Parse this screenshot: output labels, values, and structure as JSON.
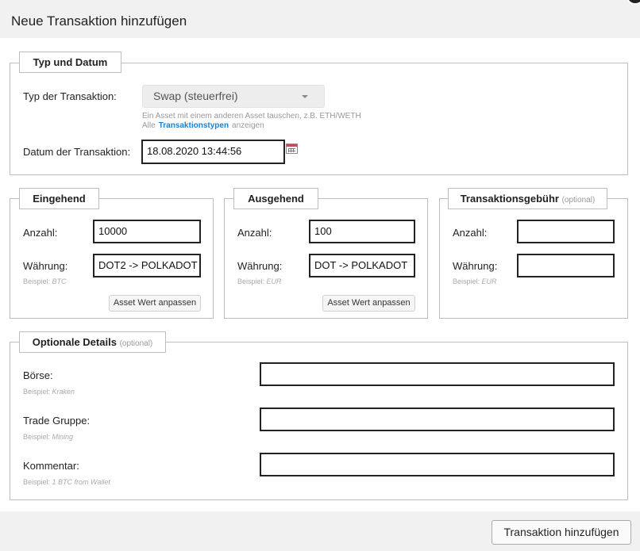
{
  "dialog": {
    "title": "Neue Transaktion hinzufügen"
  },
  "type_section": {
    "legend": "Typ und Datum",
    "type_label": "Typ der Transaktion:",
    "type_value": "Swap (steuerfrei)",
    "type_hint": "Ein Asset mit einem anderen Asset tauschen, z.B. ETH/WETH",
    "hint_prefix": "Alle",
    "hint_link": "Transaktionstypen",
    "hint_suffix": "anzeigen",
    "date_label": "Datum der Transaktion:",
    "date_value": "18.08.2020 13:44:56"
  },
  "incoming": {
    "legend": "Eingehend",
    "amount_label": "Anzahl:",
    "amount_value": "10000",
    "currency_label": "Währung:",
    "currency_value": "DOT2 -> POLKADOT",
    "example_prefix": "Beispiel:",
    "example_value": "BTC",
    "adjust_button": "Asset Wert anpassen"
  },
  "outgoing": {
    "legend": "Ausgehend",
    "amount_label": "Anzahl:",
    "amount_value": "100",
    "currency_label": "Währung:",
    "currency_value": "DOT -> POLKADOT",
    "example_prefix": "Beispiel:",
    "example_value": "EUR",
    "adjust_button": "Asset Wert anpassen"
  },
  "fee": {
    "legend": "Transaktionsgebühr",
    "legend_optional": "(optional)",
    "amount_label": "Anzahl:",
    "amount_value": "",
    "currency_label": "Währung:",
    "currency_value": "",
    "example_prefix": "Beispiel:",
    "example_value": "EUR"
  },
  "optional": {
    "legend": "Optionale Details",
    "legend_optional": "(optional)",
    "exchange_label": "Börse:",
    "exchange_example_prefix": "Beispiel:",
    "exchange_example": "Kraken",
    "exchange_value": "",
    "group_label": "Trade Gruppe:",
    "group_example_prefix": "Beispiel:",
    "group_example": "Mining",
    "group_value": "",
    "comment_label": "Kommentar:",
    "comment_example_prefix": "Beispiel:",
    "comment_example": "1 BTC from Wallet",
    "comment_value": ""
  },
  "footer": {
    "submit_button": "Transaktion hinzufügen"
  },
  "icons": {
    "calendar": "calendar-icon",
    "dropdown": "chevron-down-icon",
    "close": "close-icon"
  },
  "colors": {
    "link": "#1c7fd0",
    "header_bg": "#f1f1f1"
  }
}
